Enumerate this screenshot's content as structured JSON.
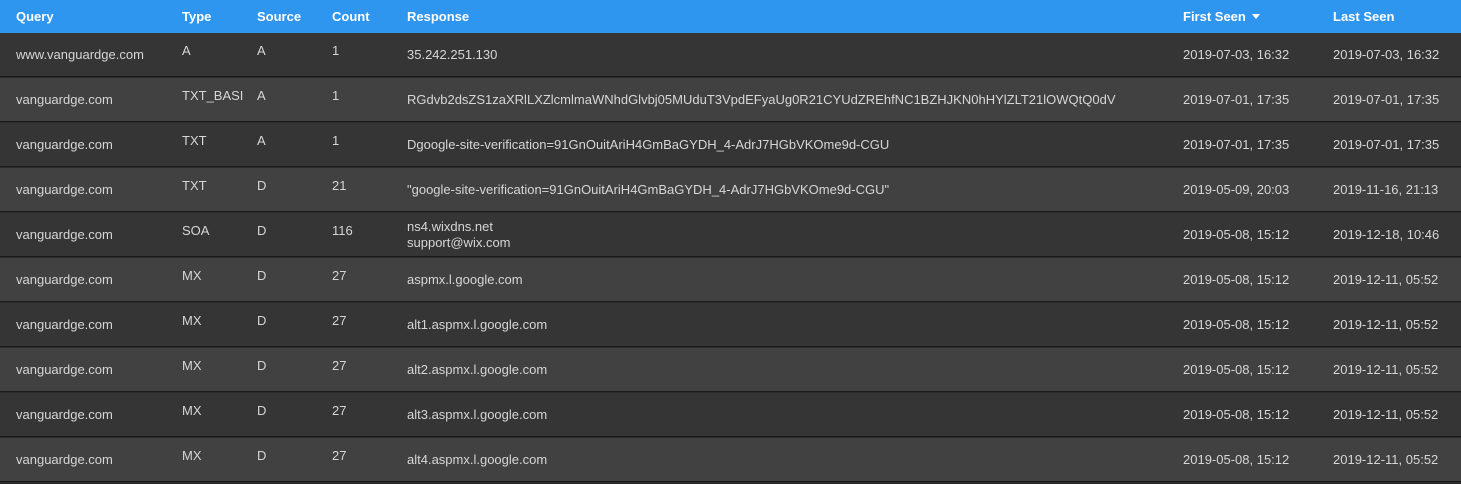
{
  "columns": {
    "query": "Query",
    "type": "Type",
    "source": "Source",
    "count": "Count",
    "response": "Response",
    "first_seen": "First Seen",
    "last_seen": "Last Seen"
  },
  "sort": {
    "column": "first_seen",
    "direction": "descending",
    "icon": "sort-down-caret-icon"
  },
  "colors": {
    "header_bg": "#2f96f0",
    "row_odd": "#353535",
    "row_even": "#414141",
    "text": "#d6d6d6"
  },
  "rows": [
    {
      "query": "www.vanguardge.com",
      "type": "A",
      "source": "A",
      "count": "1",
      "response": [
        "35.242.251.130"
      ],
      "first_seen": "2019-07-03, 16:32",
      "last_seen": "2019-07-03, 16:32"
    },
    {
      "query": "vanguardge.com",
      "type": "TXT_BASI",
      "source": "A",
      "count": "1",
      "response": [
        "RGdvb2dsZS1zaXRlLXZlcmlmaWNhdGlvbj05MUduT3VpdEFyaUg0R21CYUdZREhfNC1BZHJKN0hHYlZLT21lOWQtQ0dV"
      ],
      "first_seen": "2019-07-01, 17:35",
      "last_seen": "2019-07-01, 17:35"
    },
    {
      "query": "vanguardge.com",
      "type": "TXT",
      "source": "A",
      "count": "1",
      "response": [
        "Dgoogle-site-verification=91GnOuitAriH4GmBaGYDH_4-AdrJ7HGbVKOme9d-CGU"
      ],
      "first_seen": "2019-07-01, 17:35",
      "last_seen": "2019-07-01, 17:35"
    },
    {
      "query": "vanguardge.com",
      "type": "TXT",
      "source": "D",
      "count": "21",
      "response": [
        "\"google-site-verification=91GnOuitAriH4GmBaGYDH_4-AdrJ7HGbVKOme9d-CGU\""
      ],
      "first_seen": "2019-05-09, 20:03",
      "last_seen": "2019-11-16, 21:13"
    },
    {
      "query": "vanguardge.com",
      "type": "SOA",
      "source": "D",
      "count": "116",
      "response": [
        "ns4.wixdns.net",
        "support@wix.com"
      ],
      "first_seen": "2019-05-08, 15:12",
      "last_seen": "2019-12-18, 10:46"
    },
    {
      "query": "vanguardge.com",
      "type": "MX",
      "source": "D",
      "count": "27",
      "response": [
        "aspmx.l.google.com"
      ],
      "first_seen": "2019-05-08, 15:12",
      "last_seen": "2019-12-11, 05:52"
    },
    {
      "query": "vanguardge.com",
      "type": "MX",
      "source": "D",
      "count": "27",
      "response": [
        "alt1.aspmx.l.google.com"
      ],
      "first_seen": "2019-05-08, 15:12",
      "last_seen": "2019-12-11, 05:52"
    },
    {
      "query": "vanguardge.com",
      "type": "MX",
      "source": "D",
      "count": "27",
      "response": [
        "alt2.aspmx.l.google.com"
      ],
      "first_seen": "2019-05-08, 15:12",
      "last_seen": "2019-12-11, 05:52"
    },
    {
      "query": "vanguardge.com",
      "type": "MX",
      "source": "D",
      "count": "27",
      "response": [
        "alt3.aspmx.l.google.com"
      ],
      "first_seen": "2019-05-08, 15:12",
      "last_seen": "2019-12-11, 05:52"
    },
    {
      "query": "vanguardge.com",
      "type": "MX",
      "source": "D",
      "count": "27",
      "response": [
        "alt4.aspmx.l.google.com"
      ],
      "first_seen": "2019-05-08, 15:12",
      "last_seen": "2019-12-11, 05:52"
    }
  ]
}
